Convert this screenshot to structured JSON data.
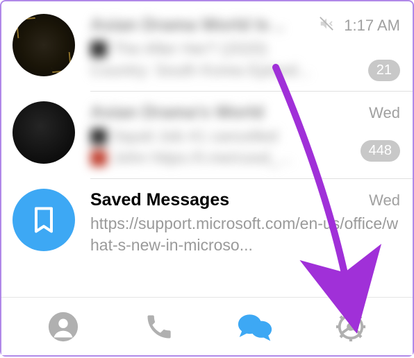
{
  "chats": [
    {
      "title": "Asian Drama World Is ..",
      "time": "1:17 AM",
      "muted": true,
      "preview_line1": "The After Her? (2020)",
      "preview_line2": "Country: South Korea   Episod...",
      "badge": "21"
    },
    {
      "title": "Asian Drama's World",
      "time": "Wed",
      "muted": false,
      "preview_line1": "Squid Job #1 cancelled",
      "preview_line2": "John  https://t.me/cood_...",
      "badge": "448"
    },
    {
      "title": "Saved Messages",
      "time": "Wed",
      "muted": false,
      "preview": "https://support.microsoft.com/en-us/office/what-s-new-in-microso...",
      "badge": null
    }
  ],
  "tabs": {
    "contacts": "contacts",
    "calls": "calls",
    "chats": "chats",
    "settings": "settings"
  },
  "colors": {
    "accent": "#3da8f4",
    "arrow": "#a030d8",
    "badge_bg": "#c8c8c8",
    "muted_text": "#9a9a9a"
  }
}
